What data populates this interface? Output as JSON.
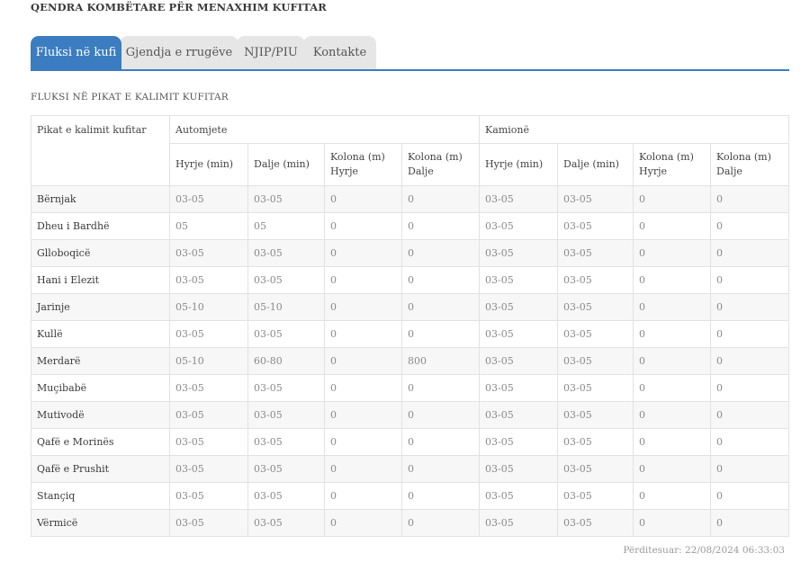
{
  "site_title": "QENDRA KOMBËTARE PËR MENAXHIM KUFITAR",
  "tabs": [
    {
      "label": "Fluksi në kufi",
      "active": true
    },
    {
      "label": "Gjendja e rrugëve",
      "active": false
    },
    {
      "label": "NJIP/PIU",
      "active": false
    },
    {
      "label": "Kontakte",
      "active": false
    }
  ],
  "section_heading": "FLUKSI NË PIKAT E KALIMIT KUFITAR",
  "table": {
    "point_header": "Pikat e kalimit kufitar",
    "group_cars": "Automjete",
    "group_trucks": "Kamionë",
    "sub_headers": {
      "in": "Hyrje (min)",
      "out": "Dalje (min)",
      "queue_in_1": "Kolona (m)",
      "queue_in_2": "Hyrje",
      "queue_out_1": "Kolona (m)",
      "queue_out_2": "Dalje"
    },
    "rows": [
      [
        "Bërnjak",
        "03-05",
        "03-05",
        "0",
        "0",
        "03-05",
        "03-05",
        "0",
        "0"
      ],
      [
        "Dheu i Bardhë",
        "05",
        "05",
        "0",
        "0",
        "03-05",
        "03-05",
        "0",
        "0"
      ],
      [
        "Glloboqicë",
        "03-05",
        "03-05",
        "0",
        "0",
        "03-05",
        "03-05",
        "0",
        "0"
      ],
      [
        "Hani i Elezit",
        "03-05",
        "03-05",
        "0",
        "0",
        "03-05",
        "03-05",
        "0",
        "0"
      ],
      [
        "Jarinje",
        "05-10",
        "05-10",
        "0",
        "0",
        "03-05",
        "03-05",
        "0",
        "0"
      ],
      [
        "Kullë",
        "03-05",
        "03-05",
        "0",
        "0",
        "03-05",
        "03-05",
        "0",
        "0"
      ],
      [
        "Merdarë",
        "05-10",
        "60-80",
        "0",
        "800",
        "03-05",
        "03-05",
        "0",
        "0"
      ],
      [
        "Muçibabë",
        "03-05",
        "03-05",
        "0",
        "0",
        "03-05",
        "03-05",
        "0",
        "0"
      ],
      [
        "Mutivodë",
        "03-05",
        "03-05",
        "0",
        "0",
        "03-05",
        "03-05",
        "0",
        "0"
      ],
      [
        "Qafë e Morinës",
        "03-05",
        "03-05",
        "0",
        "0",
        "03-05",
        "03-05",
        "0",
        "0"
      ],
      [
        "Qafë e Prushit",
        "03-05",
        "03-05",
        "0",
        "0",
        "03-05",
        "03-05",
        "0",
        "0"
      ],
      [
        "Stançiq",
        "03-05",
        "03-05",
        "0",
        "0",
        "03-05",
        "03-05",
        "0",
        "0"
      ],
      [
        "Vërmicë",
        "03-05",
        "03-05",
        "0",
        "0",
        "03-05",
        "03-05",
        "0",
        "0"
      ]
    ]
  },
  "updated": "Përditesuar: 22/08/2024 06:33:03",
  "colors": {
    "accent": "#3b7dc0",
    "tab_inactive": "#e6e6e6"
  }
}
